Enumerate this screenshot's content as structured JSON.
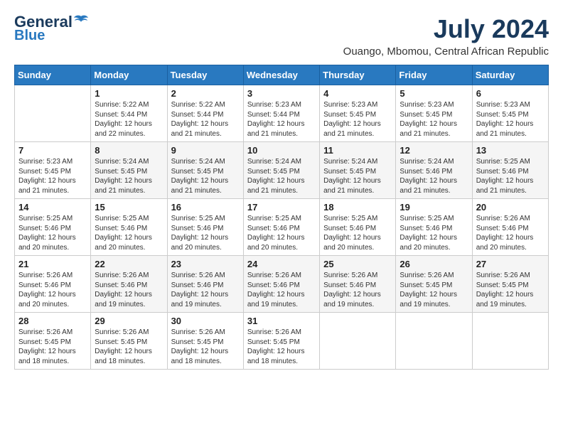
{
  "logo": {
    "general": "General",
    "blue": "Blue"
  },
  "header": {
    "month_year": "July 2024",
    "location": "Ouango, Mbomou, Central African Republic"
  },
  "weekdays": [
    "Sunday",
    "Monday",
    "Tuesday",
    "Wednesday",
    "Thursday",
    "Friday",
    "Saturday"
  ],
  "weeks": [
    [
      {
        "day": "",
        "info": ""
      },
      {
        "day": "1",
        "info": "Sunrise: 5:22 AM\nSunset: 5:44 PM\nDaylight: 12 hours\nand 22 minutes."
      },
      {
        "day": "2",
        "info": "Sunrise: 5:22 AM\nSunset: 5:44 PM\nDaylight: 12 hours\nand 21 minutes."
      },
      {
        "day": "3",
        "info": "Sunrise: 5:23 AM\nSunset: 5:44 PM\nDaylight: 12 hours\nand 21 minutes."
      },
      {
        "day": "4",
        "info": "Sunrise: 5:23 AM\nSunset: 5:45 PM\nDaylight: 12 hours\nand 21 minutes."
      },
      {
        "day": "5",
        "info": "Sunrise: 5:23 AM\nSunset: 5:45 PM\nDaylight: 12 hours\nand 21 minutes."
      },
      {
        "day": "6",
        "info": "Sunrise: 5:23 AM\nSunset: 5:45 PM\nDaylight: 12 hours\nand 21 minutes."
      }
    ],
    [
      {
        "day": "7",
        "info": "Sunrise: 5:23 AM\nSunset: 5:45 PM\nDaylight: 12 hours\nand 21 minutes."
      },
      {
        "day": "8",
        "info": "Sunrise: 5:24 AM\nSunset: 5:45 PM\nDaylight: 12 hours\nand 21 minutes."
      },
      {
        "day": "9",
        "info": "Sunrise: 5:24 AM\nSunset: 5:45 PM\nDaylight: 12 hours\nand 21 minutes."
      },
      {
        "day": "10",
        "info": "Sunrise: 5:24 AM\nSunset: 5:45 PM\nDaylight: 12 hours\nand 21 minutes."
      },
      {
        "day": "11",
        "info": "Sunrise: 5:24 AM\nSunset: 5:45 PM\nDaylight: 12 hours\nand 21 minutes."
      },
      {
        "day": "12",
        "info": "Sunrise: 5:24 AM\nSunset: 5:46 PM\nDaylight: 12 hours\nand 21 minutes."
      },
      {
        "day": "13",
        "info": "Sunrise: 5:25 AM\nSunset: 5:46 PM\nDaylight: 12 hours\nand 21 minutes."
      }
    ],
    [
      {
        "day": "14",
        "info": "Sunrise: 5:25 AM\nSunset: 5:46 PM\nDaylight: 12 hours\nand 20 minutes."
      },
      {
        "day": "15",
        "info": "Sunrise: 5:25 AM\nSunset: 5:46 PM\nDaylight: 12 hours\nand 20 minutes."
      },
      {
        "day": "16",
        "info": "Sunrise: 5:25 AM\nSunset: 5:46 PM\nDaylight: 12 hours\nand 20 minutes."
      },
      {
        "day": "17",
        "info": "Sunrise: 5:25 AM\nSunset: 5:46 PM\nDaylight: 12 hours\nand 20 minutes."
      },
      {
        "day": "18",
        "info": "Sunrise: 5:25 AM\nSunset: 5:46 PM\nDaylight: 12 hours\nand 20 minutes."
      },
      {
        "day": "19",
        "info": "Sunrise: 5:25 AM\nSunset: 5:46 PM\nDaylight: 12 hours\nand 20 minutes."
      },
      {
        "day": "20",
        "info": "Sunrise: 5:26 AM\nSunset: 5:46 PM\nDaylight: 12 hours\nand 20 minutes."
      }
    ],
    [
      {
        "day": "21",
        "info": "Sunrise: 5:26 AM\nSunset: 5:46 PM\nDaylight: 12 hours\nand 20 minutes."
      },
      {
        "day": "22",
        "info": "Sunrise: 5:26 AM\nSunset: 5:46 PM\nDaylight: 12 hours\nand 19 minutes."
      },
      {
        "day": "23",
        "info": "Sunrise: 5:26 AM\nSunset: 5:46 PM\nDaylight: 12 hours\nand 19 minutes."
      },
      {
        "day": "24",
        "info": "Sunrise: 5:26 AM\nSunset: 5:46 PM\nDaylight: 12 hours\nand 19 minutes."
      },
      {
        "day": "25",
        "info": "Sunrise: 5:26 AM\nSunset: 5:46 PM\nDaylight: 12 hours\nand 19 minutes."
      },
      {
        "day": "26",
        "info": "Sunrise: 5:26 AM\nSunset: 5:45 PM\nDaylight: 12 hours\nand 19 minutes."
      },
      {
        "day": "27",
        "info": "Sunrise: 5:26 AM\nSunset: 5:45 PM\nDaylight: 12 hours\nand 19 minutes."
      }
    ],
    [
      {
        "day": "28",
        "info": "Sunrise: 5:26 AM\nSunset: 5:45 PM\nDaylight: 12 hours\nand 18 minutes."
      },
      {
        "day": "29",
        "info": "Sunrise: 5:26 AM\nSunset: 5:45 PM\nDaylight: 12 hours\nand 18 minutes."
      },
      {
        "day": "30",
        "info": "Sunrise: 5:26 AM\nSunset: 5:45 PM\nDaylight: 12 hours\nand 18 minutes."
      },
      {
        "day": "31",
        "info": "Sunrise: 5:26 AM\nSunset: 5:45 PM\nDaylight: 12 hours\nand 18 minutes."
      },
      {
        "day": "",
        "info": ""
      },
      {
        "day": "",
        "info": ""
      },
      {
        "day": "",
        "info": ""
      }
    ]
  ]
}
